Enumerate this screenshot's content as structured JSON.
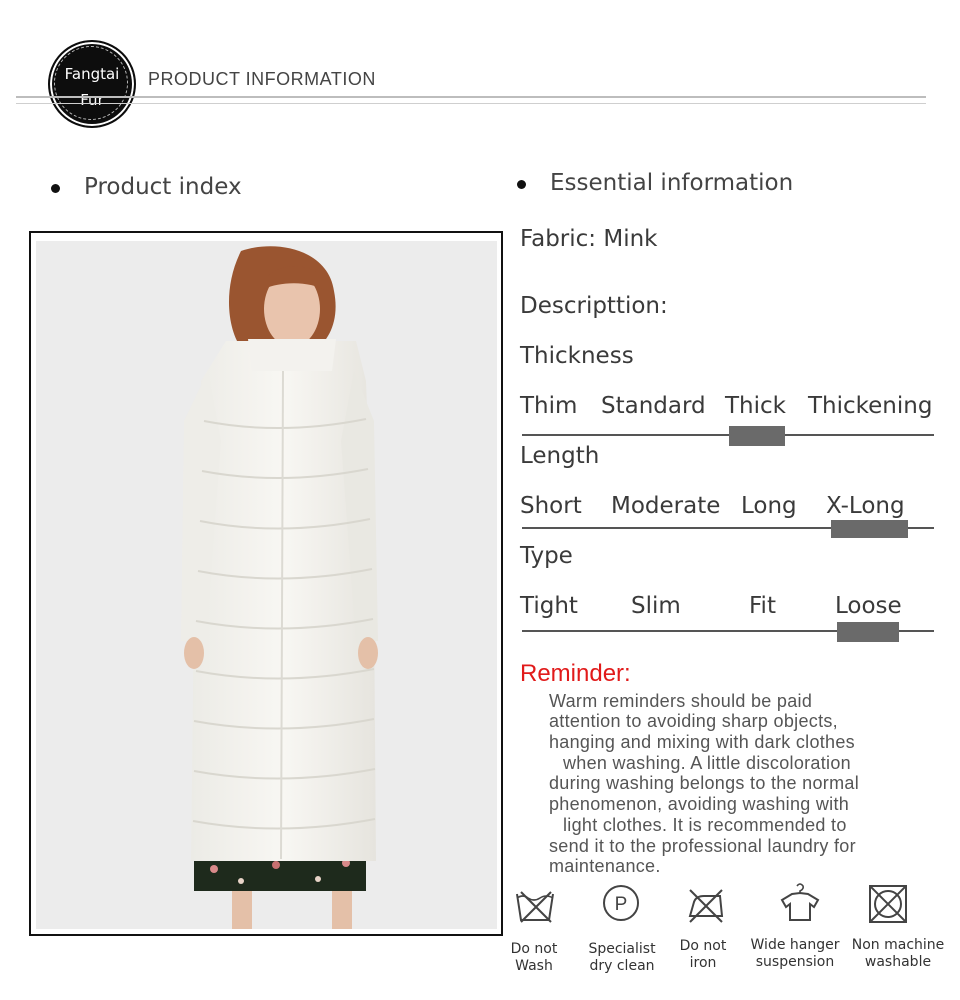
{
  "header": {
    "logo_line1": "Fangtai",
    "logo_line2": "Fur",
    "title": "PRODUCT INFORMATION"
  },
  "left": {
    "section_title": "Product index"
  },
  "right": {
    "section_title": "Essential information",
    "fabric": "Fabric: Mink",
    "description_label": "Descripttion:",
    "thickness": {
      "label": "Thickness",
      "options": [
        "Thim",
        "Standard",
        "Thick",
        "Thickening"
      ],
      "selected": "Thick"
    },
    "length": {
      "label": "Length",
      "options": [
        "Short",
        "Moderate",
        "Long",
        "X-Long"
      ],
      "selected": "X-Long"
    },
    "type": {
      "label": "Type",
      "options": [
        "Tight",
        "Slim",
        "Fit",
        "Loose"
      ],
      "selected": "Loose"
    }
  },
  "reminder": {
    "title": "Reminder:",
    "lines": [
      "Warm  reminders  should  be  paid",
      "attention  to  avoiding  sharp  objects,",
      "hanging  and  mixing  with  dark  clothes",
      "when  washing.  A  little  discoloration",
      "during  washing  belongs  to  the  normal",
      "phenomenon,  avoiding  washing  with",
      "light  clothes.  It  is  recommended  to",
      "send  it  to  the  professional  laundry  for",
      "maintenance."
    ]
  },
  "care": [
    {
      "icon": "do-not-wash-icon",
      "line1": "Do not",
      "line2": "Wash"
    },
    {
      "icon": "dry-clean-icon",
      "line1": "Specialist",
      "line2": "dry clean"
    },
    {
      "icon": "do-not-iron-icon",
      "line1": "Do not",
      "line2": "iron"
    },
    {
      "icon": "hanger-icon",
      "line1": "Wide hanger",
      "line2": "suspension"
    },
    {
      "icon": "no-machine-wash-icon",
      "line1": "Non machine",
      "line2": "washable"
    }
  ],
  "colors": {
    "reminder_title": "#e11a1a",
    "marker": "#6a6a6a",
    "text": "#3a3a3a"
  }
}
